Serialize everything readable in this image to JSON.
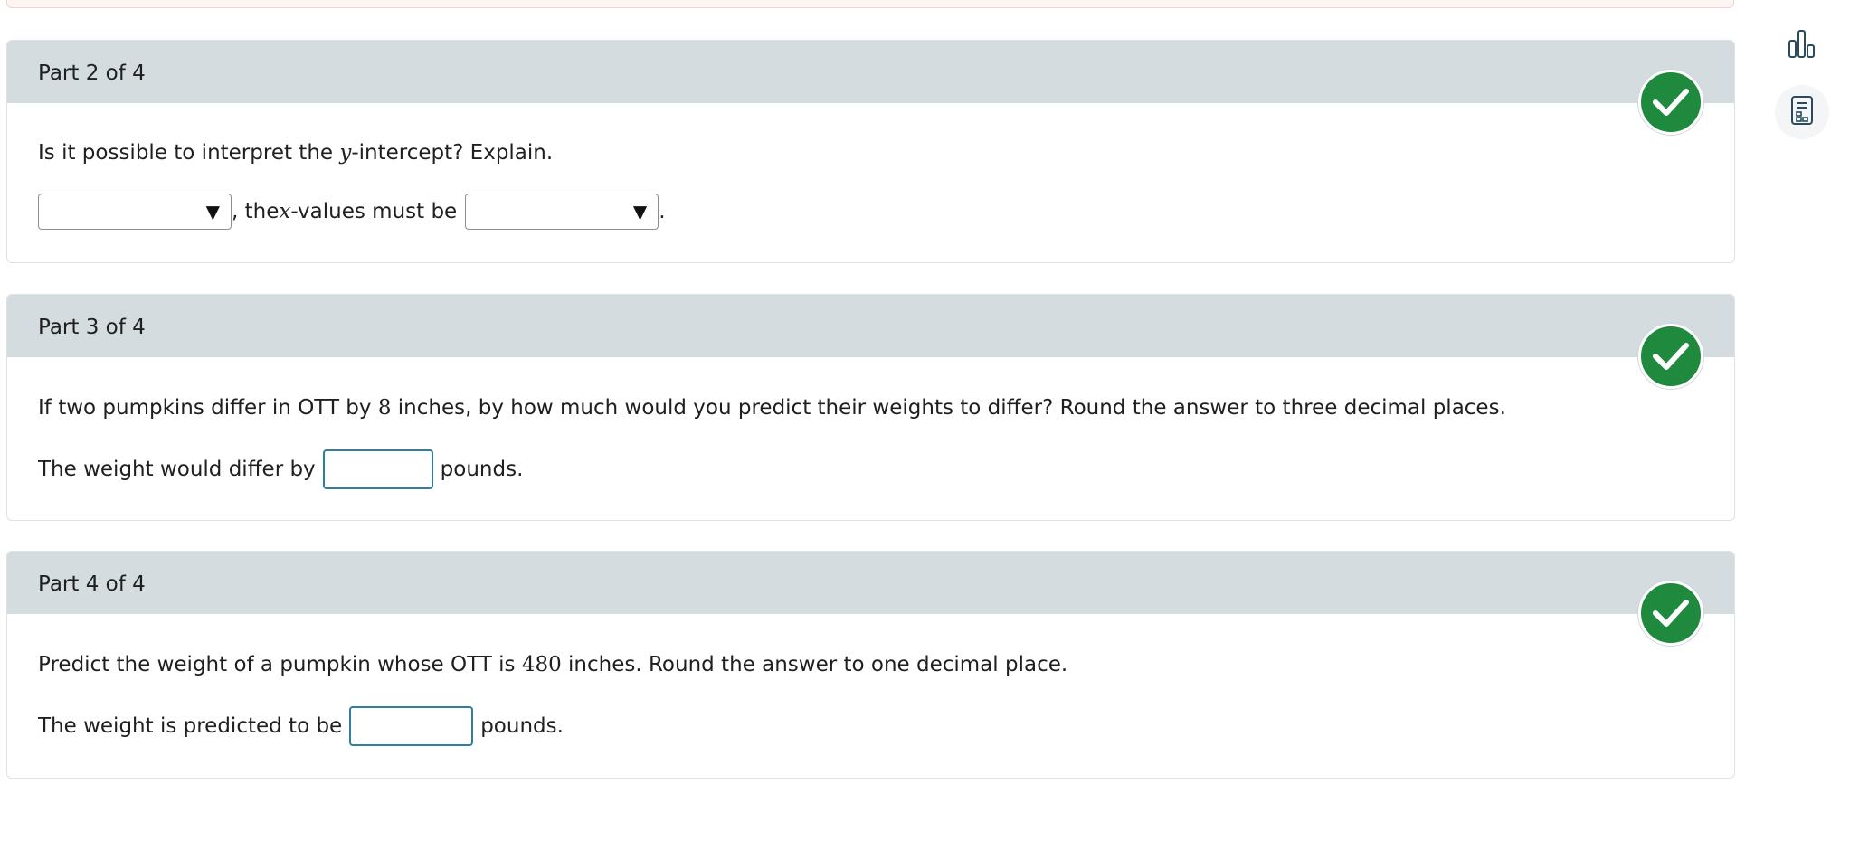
{
  "part2": {
    "title": "Part 2 of 4",
    "question_before": "Is it possible to interpret the ",
    "var_y": "y",
    "question_after": "-intercept? Explain.",
    "dropdown1_value": "",
    "mid_before": ", the ",
    "var_x": "x",
    "mid_after": "-values must be",
    "dropdown2_value": "",
    "end_punct": "."
  },
  "part3": {
    "title": "Part 3 of 4",
    "q_before": "If two pumpkins differ in OTT by ",
    "q_num": "8",
    "q_after": " inches, by how much would you predict their weights to differ? Round the answer to three decimal places.",
    "answer_prefix": "The weight would differ by",
    "answer_value": "",
    "answer_suffix": "pounds."
  },
  "part4": {
    "title": "Part 4 of 4",
    "q_before": "Predict the weight of a pumpkin whose OTT is ",
    "q_num": "480",
    "q_after": " inches. Round the answer to one decimal place.",
    "answer_prefix": "The weight is predicted to be",
    "answer_value": "",
    "answer_suffix": "pounds."
  },
  "status": {
    "check_color": "#1f8a3d",
    "header_color": "#d4dcdf"
  },
  "side_tools": [
    "bar-chart-icon",
    "calculator-icon"
  ]
}
